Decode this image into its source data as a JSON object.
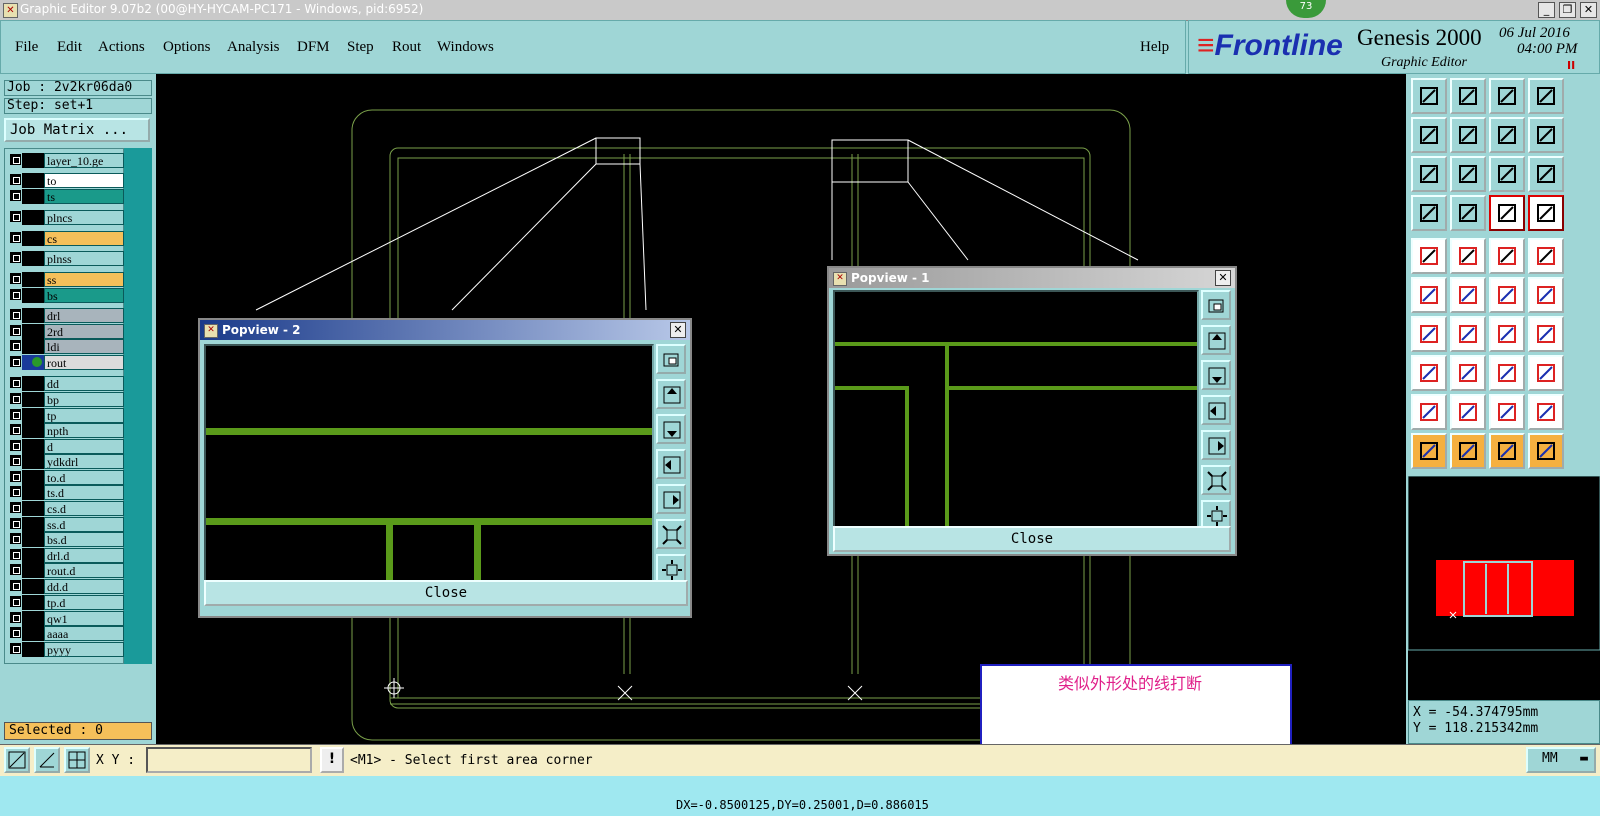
{
  "window": {
    "title": "Graphic Editor 9.07b2 (00@HY-HYCAM-PC171 - Windows, pid:6952)",
    "badge": "73",
    "buttons": [
      "_",
      "❐",
      "✕"
    ]
  },
  "menu": {
    "items": [
      "File",
      "Edit",
      "Actions",
      "Options",
      "Analysis",
      "DFM",
      "Step",
      "Rout",
      "Windows"
    ],
    "help": "Help"
  },
  "brand": {
    "logo": "Frontline",
    "product": "Genesis 2000",
    "subtitle": "Graphic Editor",
    "date": "06 Jul 2016",
    "time": "04:00 PM",
    "pause": "II"
  },
  "left": {
    "job": "Job : 2v2kr06da0",
    "step": "Step: set+1",
    "job_matrix": "Job Matrix ...",
    "layers": [
      {
        "name": "layer_10.ge",
        "color": "#9fd6d6"
      },
      {
        "name": "to",
        "color": "#ffffff"
      },
      {
        "name": "ts",
        "color": "#1a9a8a"
      },
      {
        "name": "plncs",
        "color": "#9fd6d6"
      },
      {
        "name": "cs",
        "color": "#f5c05a"
      },
      {
        "name": "plnss",
        "color": "#9fd6d6"
      },
      {
        "name": "ss",
        "color": "#f5c05a"
      },
      {
        "name": "bs",
        "color": "#1a9a8a"
      },
      {
        "name": "drl",
        "color": "#a8b4bc"
      },
      {
        "name": "2rd",
        "color": "#a8b4bc"
      },
      {
        "name": "ldi",
        "color": "#a8b4bc"
      },
      {
        "name": "rout",
        "color": "#dcdcdc"
      },
      {
        "name": "dd",
        "color": "#9fd6d6"
      },
      {
        "name": "bp",
        "color": "#9fd6d6"
      },
      {
        "name": "tp",
        "color": "#9fd6d6"
      },
      {
        "name": "npth",
        "color": "#9fd6d6"
      },
      {
        "name": "d",
        "color": "#9fd6d6"
      },
      {
        "name": "ydkdrl",
        "color": "#9fd6d6"
      },
      {
        "name": "to.d",
        "color": "#9fd6d6"
      },
      {
        "name": "ts.d",
        "color": "#9fd6d6"
      },
      {
        "name": "cs.d",
        "color": "#9fd6d6"
      },
      {
        "name": "ss.d",
        "color": "#9fd6d6"
      },
      {
        "name": "bs.d",
        "color": "#9fd6d6"
      },
      {
        "name": "drl.d",
        "color": "#9fd6d6"
      },
      {
        "name": "rout.d",
        "color": "#9fd6d6"
      },
      {
        "name": "dd.d",
        "color": "#9fd6d6"
      },
      {
        "name": "tp.d",
        "color": "#9fd6d6"
      },
      {
        "name": "qw1",
        "color": "#9fd6d6"
      },
      {
        "name": "aaaa",
        "color": "#9fd6d6"
      },
      {
        "name": "pyyy",
        "color": "#9fd6d6"
      }
    ],
    "selected": "Selected : 0"
  },
  "popview2": {
    "title": "Popview - 2",
    "close": "Close"
  },
  "popview1": {
    "title": "Popview - 1",
    "close": "Close"
  },
  "note": {
    "text": "类似外形处的线打断"
  },
  "bottom": {
    "xy_label": "X Y :",
    "xy_value": "",
    "excl": "!",
    "prompt": "<M1> - Select first area corner",
    "unit": "MM"
  },
  "coords": {
    "x": "X = -54.374795mm",
    "y": "Y = 118.215342mm"
  },
  "status": "DX=-0.8500125,DY=0.25001,D=0.886015",
  "colors": {
    "bg": "#9fd6d6",
    "canvas": "#000000",
    "trace": "#5a9a1a",
    "outline": "#7aa04a"
  }
}
